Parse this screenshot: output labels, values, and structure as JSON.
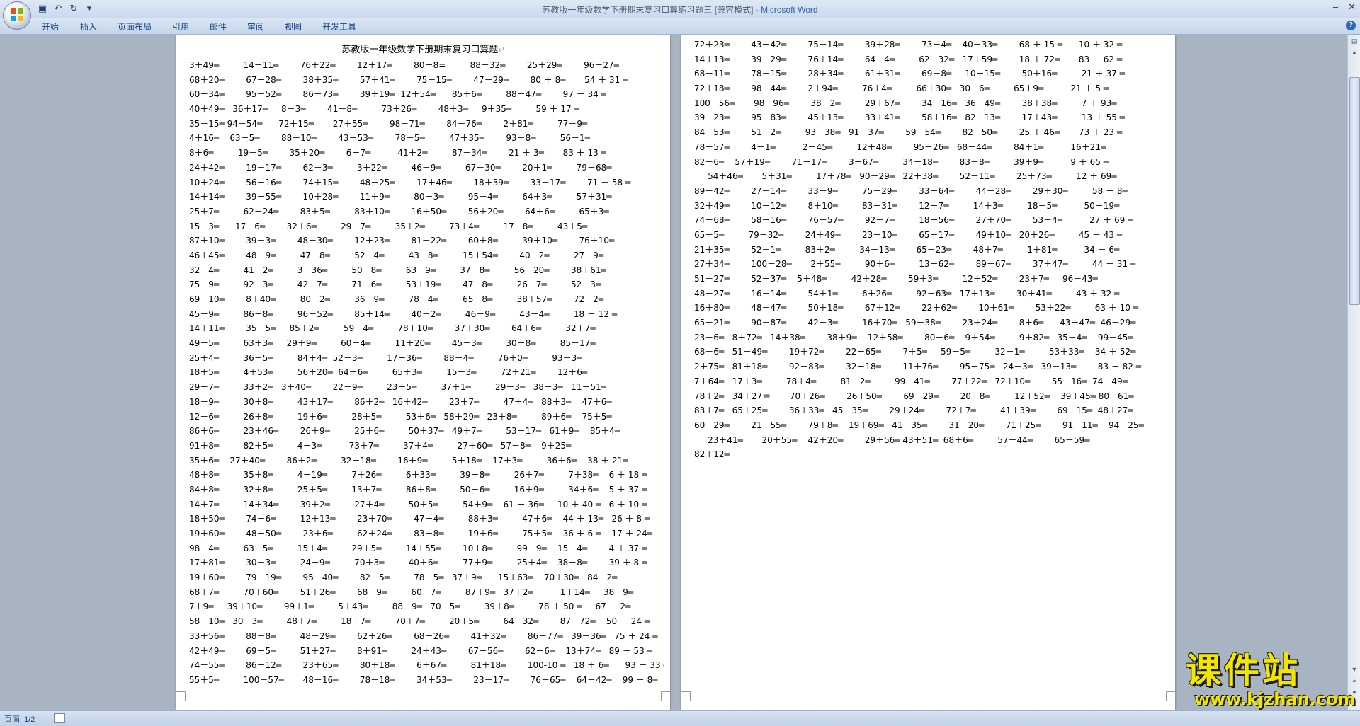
{
  "window": {
    "title": "苏教版一年级数学下册期末复习口算练习题三 [兼容模式] - ",
    "app_name": "Microsoft Word",
    "minimize": "–",
    "close": "✕"
  },
  "quick_access": {
    "save_icon": "save-icon",
    "undo_icon": "undo-icon",
    "redo_icon": "redo-icon",
    "customize_icon": "customize-icon"
  },
  "ribbon": {
    "tabs": [
      "开始",
      "插入",
      "页面布局",
      "引用",
      "邮件",
      "审阅",
      "视图",
      "开发工具"
    ]
  },
  "document": {
    "title": "苏教版一年级数学下册期末复习口算题",
    "page1_lines": [
      "3＋49═         14－11═        76＋22═        12＋17═        80＋8=         88－32═        25＋29═        96－27═",
      "68＋20═        67＋28═        38＋35═        57＋41═        75－15═        47－29═        80 ＋ 8═       54 ＋ 31 ═",
      "60－34═        95－52═        86－73═        39＋19═  12＋54═      85＋6═         88－47═        97 － 34 ═",
      "40＋49═   36＋17═     8－3═        41－8═         73＋26═        48＋3═     9＋35═         59 ＋ 17 ═",
      "35－15═ 94－54═      72＋15═       27＋55═        98－71═        84－76═        2＋81═         77－9═",
      "4＋16═    63－5═        88－10═        43＋53═        78－5═         47＋35═        93－8═         56－1═",
      "8＋6═         19－5═        35＋20═        6＋7═          41＋2═         87－34═        21 ＋ 3═       83 ＋ 13 ═",
      "24＋42═        19－17═        62－3═         3＋22═         46－9═         67－30═        20＋1═         79－68═",
      "10＋24═        56＋16═        74＋15═        48－25═        17＋46═        18＋39═        33－17═        71 － 58 ═",
      "14＋14═        39＋55═        10＋28═        11＋9═         80－3═         95－4═         64＋3═         57＋31═",
      "25＋7═         62－24═        83＋5═         83＋10═        16＋50═        56＋20═        64＋6═         65＋3═",
      "15－3═      17－6═        32＋6═         29－7═         35＋2═         73＋4═         17－8═         43＋5═",
      "87＋10═        39－3═        48－30═        12＋23═        81－22═        60＋8═         39＋10═        76＋10═",
      "46＋45═        48－9═         47－8═         52－4═         43－8═         15＋54═        40－2═         27－9═",
      "32－4═         41－2═         3＋36═         50－8═         63－9═         37－8═         56－20═        38＋61═",
      "75－9═         92－3═         42－7═         71－6═         53＋19═        47－8═         26－7═         52－3═",
      "69－10═        8＋40═         80－2═         36－9═         78－4═         65－8═         38＋57═        72－2═",
      "45－9═         86－8═         96－52═        85＋14═        40－2═         46－9═         43－4═         18 － 12 ═",
      "14＋11═        35＋5═     85＋2═         59－4═         78＋10═        37＋30═        64＋6═         32＋7═",
      "49－5═         63＋3═     29＋9═         60－4═         11＋20═        45－3═         30＋8═         85－17═",
      "25＋4═         36－5═         84＋4═  52－3═         17＋36═        88－4═         76＋0═         93－3═",
      "18＋5═         4＋53═         56＋20═  64＋6═         65＋3═         15－3═         72＋21═        12＋6═",
      "29－7═         33＋2═   3＋40═        22－9═         23＋5═         37＋1═         29－3═   38－3═   11＋51═",
      "18－9═         30＋8═         43＋17═        86＋2═   16＋42═        23＋7═         47＋4═   88＋3═    47＋6═",
      "12－6═         26＋8═         19＋6═         28＋5═         53＋6═   58＋29═   23＋8═         89＋6═    75＋5═",
      "86＋6═         23＋46═        26＋9═         25＋6═         50＋37═   49＋7═         53＋17═   61＋9═    85＋4═",
      "91＋8═         82＋5═         4＋3═          73＋7═         37＋4═         27＋60═   57－8═    9＋25═",
      "35＋6═    27＋40═        86＋2═         32＋18═        16＋9═         5＋18═    17＋3═         36＋6═    38 ＋ 21═",
      "48＋8═         35＋8═         4＋19═         7＋26═         6＋33═         39＋8═         26＋7═         7＋38═    6 ＋ 18 ═",
      "84＋8═         32＋8═         25＋5═         13＋7═         86＋8═         50－6═         16＋9═         34＋6═    5 ＋ 37 ═",
      "14＋7═         14＋34═        39＋2═         27＋4═         50＋5═         54＋9═    61 ＋ 36═     10 ＋ 40 ═   6 ＋ 10 ═",
      "18＋50═        74＋6═         12＋13═        23＋70═        47＋4═         88＋3═         47＋6═    44 ＋ 13═   26 ＋ 8 ═",
      "19＋60═        48＋50═        23＋6═         62＋24═        83＋8═         19＋6═         75＋5═    36 ＋ 6 ═    17 ＋ 24═",
      "98－4═         63－5═         15＋4═         29＋5═         14＋55═        10＋8═         99－9═    15－4═        4 ＋ 37 ═",
      "17＋81═        30－3═         24－9═         70＋3═         40＋6═         77＋9═         25＋4═    38－8═        39 ＋ 8 ═",
      "19＋60═        79－19═        95－40═        82－5═         78＋5═   37＋9═      15＋63═    70＋30═   84－2═",
      "68＋7═         70＋60═        51＋26═        68－9═         60－7═         87＋9═   37＋2═          1＋14═     38－9═",
      "7＋9═     39＋10═        99＋1═         5＋43═         88－9═   70－5═         39＋8═         78 ＋ 50 ═     67 － 2═",
      "58－10═   30－3═         48＋7═         18＋7═         70＋7═         20＋5═         64－32═        87－72═    50 － 24 ═",
      "33＋56═        88－8═         48－29═        62＋26═        68－26═        41＋32═        86－77═   39－36═   75 ＋ 24 ═",
      "42＋49═        69＋5═         51＋27═        8＋91═         24＋43═        67－56═        62－6═    13＋74═   89 － 53 ═",
      "74－55═        86＋12═        23＋65═        80＋18═        6＋67═         81＋18═        100-10 ═   18 ＋ 6═      93 － 33 ═",
      "55＋5═         100－57═       48－16═        78－18═        34＋53═        23－17═        76－65═    64－42═    99 － 8═"
    ],
    "page2_lines": [
      "72＋23═        43＋42═        75－14═        39＋28═        73－4═    40－33═        68 ＋ 15 ═      10 ＋ 32 ═",
      "14＋13═        39＋29═        76＋14═        64－4═         62＋32═   17＋59═        18 ＋ 72═       83 － 62 ═",
      "68－11═        78－15═        28＋34═        61＋31═        69－8═     10＋15═        50＋16═         21 ＋ 37 ═",
      "72＋18═        98－44═        2＋94═         76＋4═         66＋30═   30－6═         65＋9═          21 ＋ 5 ═",
      "100－56═       98－96═        38－2═         29＋67═        34－16═   36＋49═        38＋38═         7 ＋ 93═",
      "39－23═        95－83═        45＋13═        33＋41═        58＋16═   82＋13═        17＋43═         13 ＋ 55 ═",
      "84－53═        51－2═         93－38═   91－37═        59－54═        82－50═        25 ＋ 46═       73 ＋ 23 ═",
      "78－57═        4－1═          2＋45═         12＋48═        95－26═   68－44═        84＋1═          16＋21═",
      "82－6═    57＋19═        71－17═        3＋67═         34－18═        83－8═         39＋9═          9 ＋ 65 ═",
      "     54＋46═       5＋31═         17＋78═   90－29═   22＋38═        52－11═        25＋73═         12 ＋ 69═",
      "89－42═        27－14═        33－9═         75－29═        33＋64═        44－28═        29＋30═         58 － 8═",
      "32＋49═        10＋12═        8＋10═         83－31═        12＋7═         14＋3═         18－5═          50－19═",
      "74－68═        58＋16═        76－57═        92－7═         18＋56═        27＋70═        53－4═          27 ＋ 69 ═",
      "65－5═         79－32═        24＋49═        23－10═        65－17═        49＋10═   20＋26═         45 － 43 ═",
      "21＋35═        52－1═         83＋2═         34－13═        65－23═        48＋7═         1＋81═          34 － 6═",
      "27＋34═        100－28═       2＋55═         90＋6═         13＋62═        89－67═        37＋47═         44 － 31 ═",
      "51－27═        52＋37═    5＋48═         42＋28═        59＋3═         12＋52═        23＋7═     96－43═",
      "48－27═        16－14═        54＋1═         6＋26═         92－63═   17＋13═        30＋41═         43 ＋ 32 ═",
      "16＋80═        48－47═        50＋18═        67＋12═        22＋62═        10＋61═        53＋22═         63 ＋ 10 ═",
      "65－21═        90－87═        42－3═         16＋70═   59－38═        23＋24═        8＋6═      43＋47═  46－29═",
      "23－6═   8＋72═   14＋38═        38＋9═    12＋58═        80－6═    9＋54═         9＋82═   35－4═    99－45═",
      "68－6═   51－49═        19＋72═        22＋65═        7＋5═     59－5═         32－1═         53＋33═    34 ＋ 52═",
      "2＋75═   81＋18═        92－83═        32＋18═        11＋76═        95－75═   24－3═   39－13═        83 － 82 ═",
      "7＋64═   17＋3═         78＋4═         81－2═         99－41═        77＋22═   72＋10═        55－16═  74－49═",
      "78＋2═   34＋27＝       70＋26═        26＋50═        69－29═        20－8═         12＋52═    39＋45═ 80－61═",
      "83＋7═   65＋25═        36＋33═   45－35═        29＋24═        72＋7═         41＋39═        69＋15═  48＋27═",
      "60－29═        21＋55═        79＋8═    19＋69═   41＋35═        31－20═        71＋25═        91－11═    94－25═",
      "     23＋41═       20＋55═    42＋20═        29＋56═ 43＋51═  68＋6═         57－44═        65－59═",
      "82＋12═"
    ],
    "paragraph_mark": "↵"
  },
  "status": {
    "page_indicator": "页面: 1/2"
  },
  "watermark": {
    "main": "课件站",
    "sub": "www.kjzhan.com"
  }
}
